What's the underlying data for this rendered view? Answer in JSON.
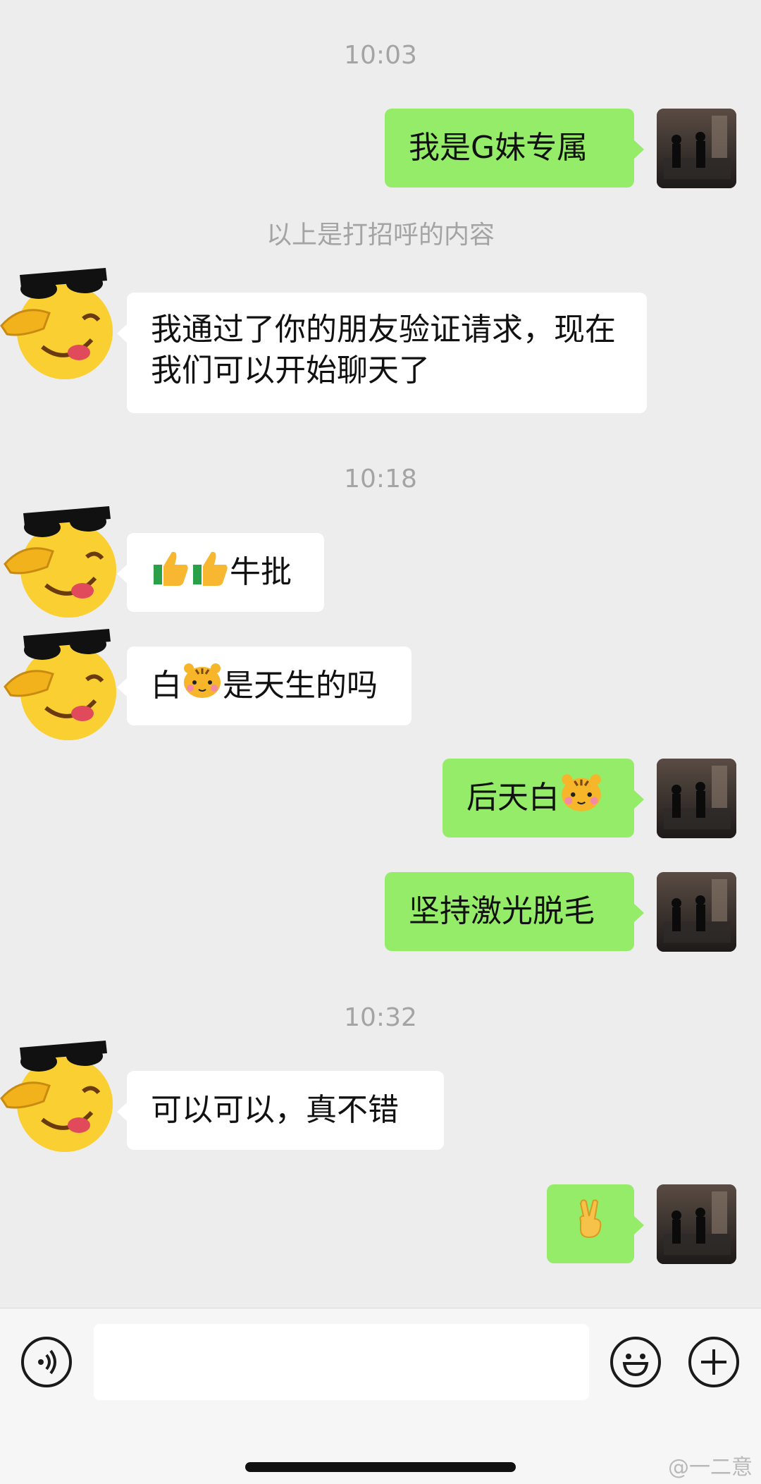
{
  "messages": {
    "t1": "10:03",
    "m1": "我是G妹专属",
    "system_note": "以上是打招呼的内容",
    "m2": "我通过了你的朋友验证请求，现在我们可以开始聊天了",
    "t2": "10:18",
    "m3_text": "牛批",
    "m4_a": "白",
    "m4_b": "是天生的吗",
    "m5": "后天白",
    "m6": "坚持激光脱毛",
    "t3": "10:32",
    "m7": "可以可以，真不错"
  },
  "icons": {
    "friend_avatar": "sunglasses-salute-emoji-avatar",
    "my_avatar": "dark-photo-avatar",
    "thumbs_up": "thumbs-up-emoji",
    "tiger": "tiger-emoji",
    "victory_hand": "victory-hand-emoji",
    "voice": "voice-icon",
    "emoji": "smiley-icon",
    "more": "plus-icon"
  },
  "input": {
    "value": ""
  },
  "watermark": "@一二意",
  "colors": {
    "outgoing_bubble": "#95ec69",
    "incoming_bubble": "#ffffff",
    "background": "#ededed"
  }
}
